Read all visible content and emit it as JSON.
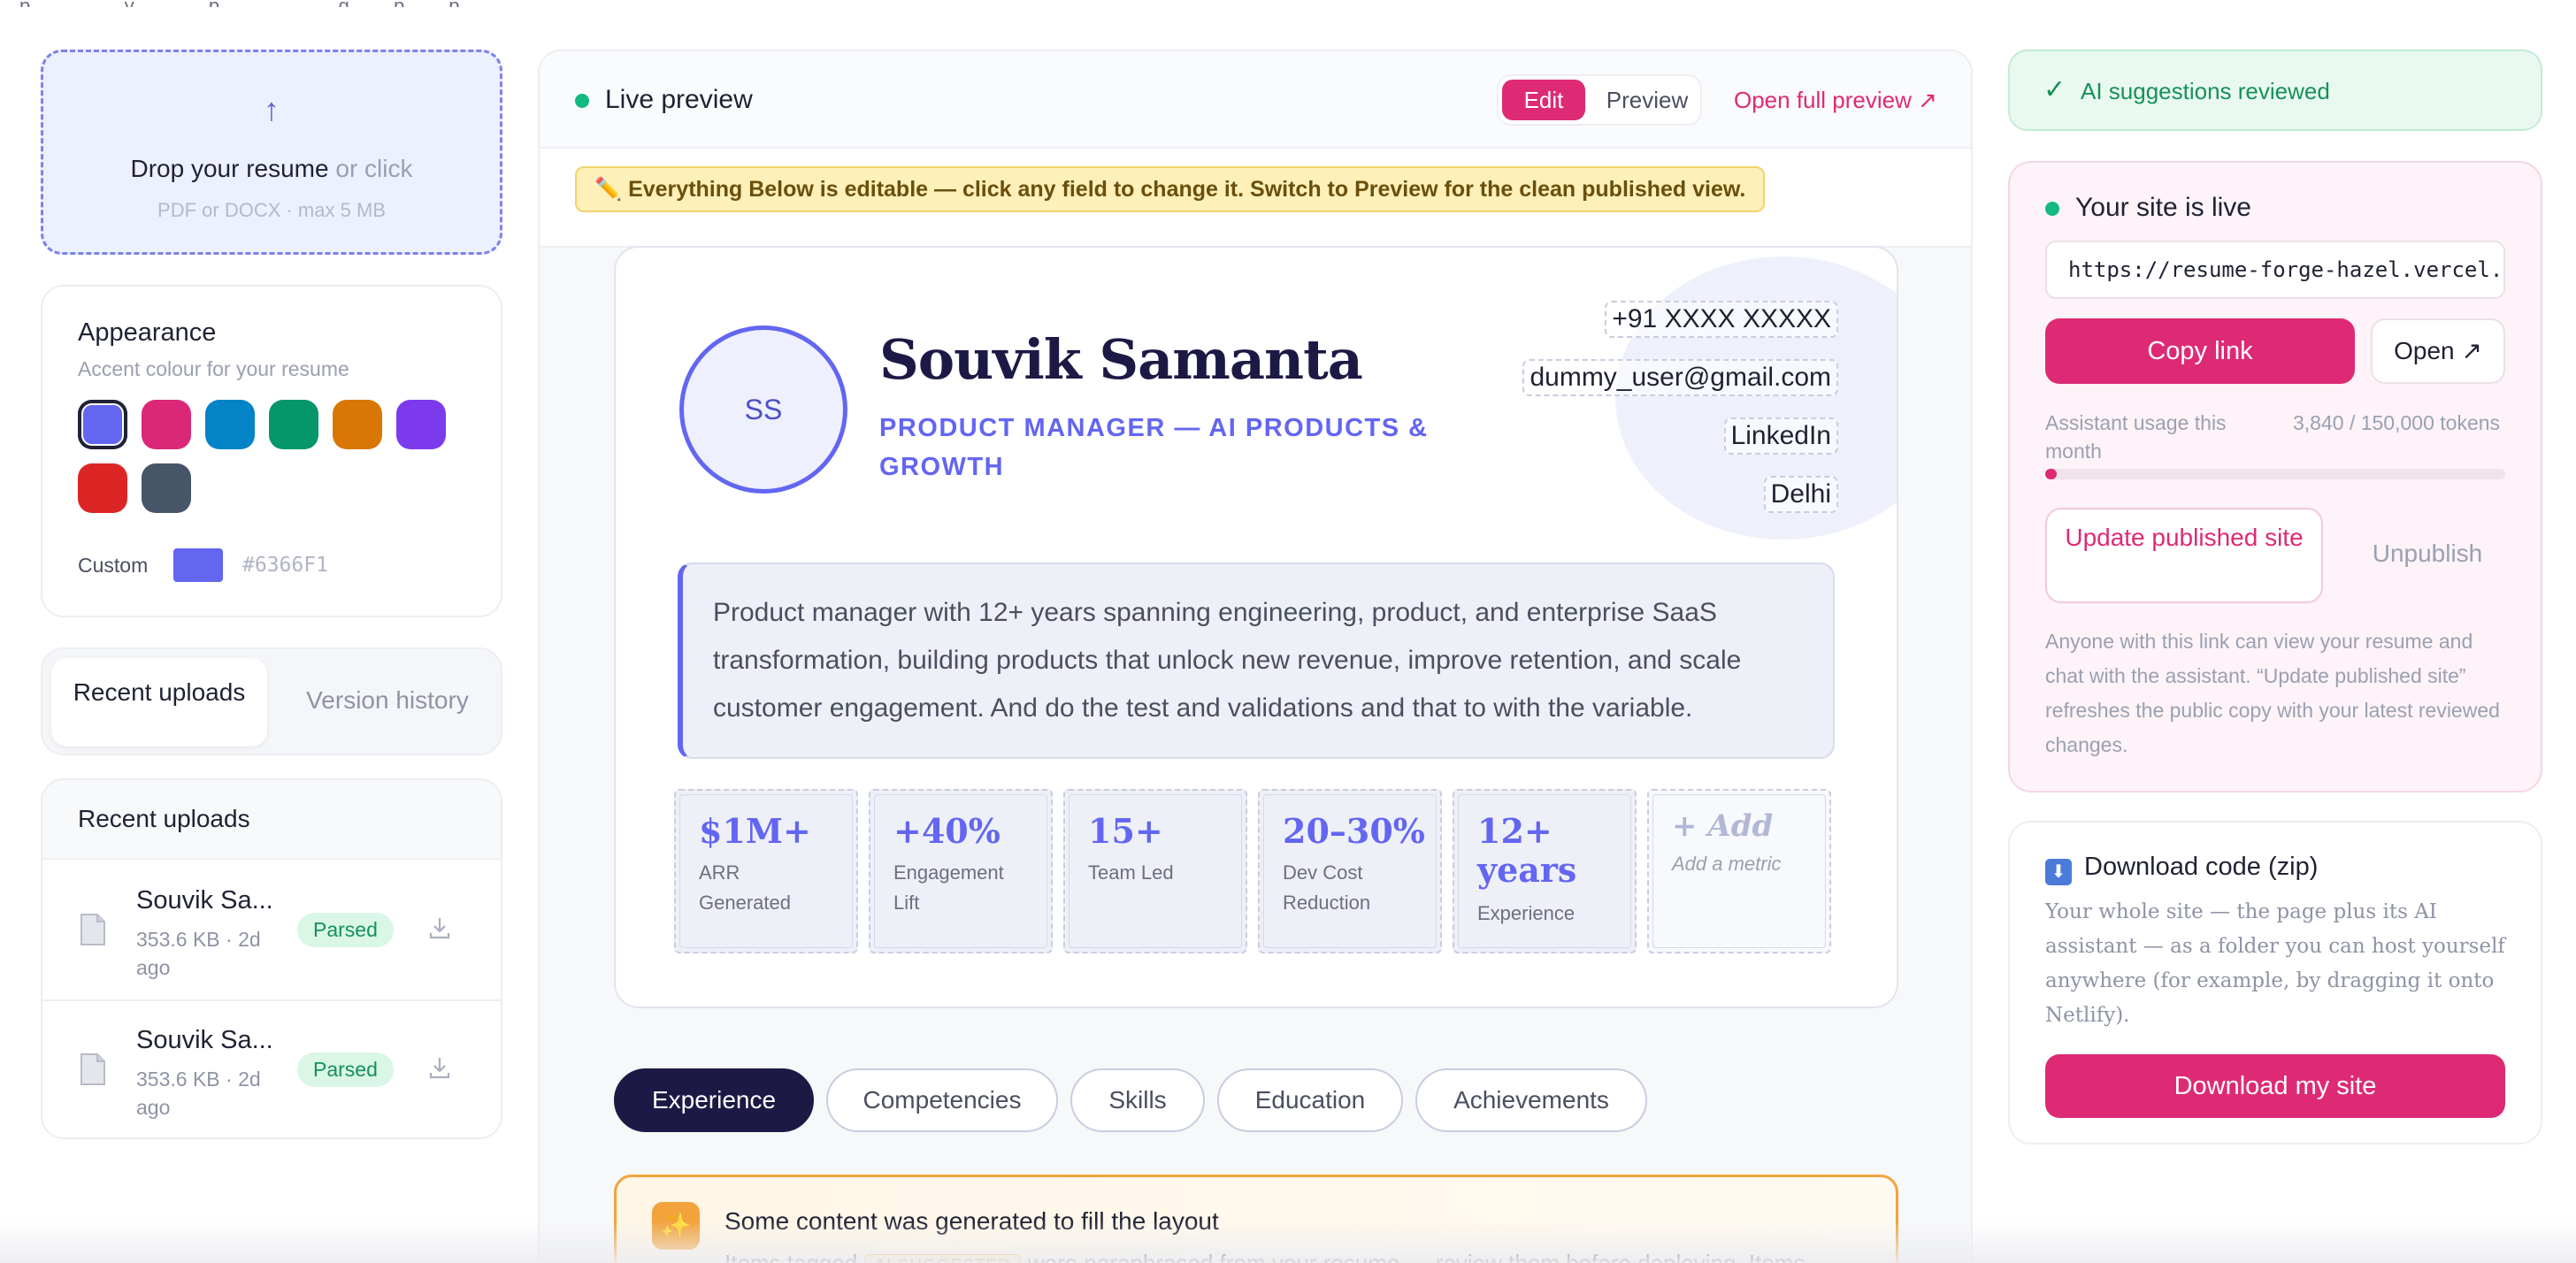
{
  "top_strip": "…p… … … …y … … …p… … … … …g… …p… …p…",
  "upload": {
    "arrow": "↑",
    "title": "Drop your resume",
    "or_click": "or click",
    "hint": "PDF or DOCX · max 5 MB"
  },
  "appearance": {
    "title": "Appearance",
    "subtitle": "Accent colour for your resume",
    "swatches": [
      "#6366F1",
      "#DB2777",
      "#0284C7",
      "#059669",
      "#D97706",
      "#7C3AED",
      "#DC2626",
      "#475569"
    ],
    "selected_index": 0,
    "custom_label": "Custom",
    "custom_hex": "#6366F1"
  },
  "left_tabs": {
    "recent": "Recent uploads",
    "history": "Version history"
  },
  "recent_uploads": {
    "title": "Recent uploads",
    "items": [
      {
        "name": "Souvik Sa...",
        "meta": "353.6 KB · 2d ago",
        "status": "Parsed"
      },
      {
        "name": "Souvik Sa...",
        "meta": "353.6 KB · 2d ago",
        "status": "Parsed"
      }
    ]
  },
  "preview": {
    "live_label": "Live preview",
    "mode_edit": "Edit",
    "mode_preview": "Preview",
    "open_full": "Open full preview ↗",
    "edit_note": "✏️ Everything Below is editable — click any field to change it. Switch to Preview for the clean published view."
  },
  "resume": {
    "initials": "SS",
    "name": "Souvik Samanta",
    "role": "PRODUCT MANAGER — AI PRODUCTS & GROWTH",
    "phone": "+91 XXXX XXXXX",
    "email": "dummy_user@gmail.com",
    "linkedin": "LinkedIn",
    "location": "Delhi",
    "summary": "Product manager with 12+ years spanning engineering, product, and enterprise SaaS transformation, building products that unlock new revenue, improve retention, and scale customer engagement. And do the test and validations and that to with the variable.",
    "metrics": [
      {
        "value": "$1M+",
        "label": "ARR Generated"
      },
      {
        "value": "+40%",
        "label": "Engagement Lift"
      },
      {
        "value": "15+",
        "label": "Team Led"
      },
      {
        "value": "20–30%",
        "label": "Dev Cost Reduction"
      },
      {
        "value": "12+ years",
        "label": "Experience"
      }
    ],
    "add_metric_value": "+ Add",
    "add_metric_label": "Add a metric"
  },
  "section_tabs": [
    "Experience",
    "Competencies",
    "Skills",
    "Education",
    "Achievements"
  ],
  "generated": {
    "icon": "✨",
    "title": "Some content was generated to fill the layout",
    "pre": "Items tagged",
    "tag": "AI SUGGESTED",
    "post": "were paraphrased from your resume — review them before deploying. Items"
  },
  "reviewed": {
    "check": "✓",
    "text": "AI suggestions reviewed"
  },
  "publish": {
    "title": "Your site is live",
    "url": "https://resume-forge-hazel.vercel.app",
    "copy": "Copy link",
    "open": "Open ↗",
    "usage_label": "Assistant usage this month",
    "usage_value": "3,840 / 150,000 tokens",
    "usage_fraction": 0.0256,
    "update": "Update published site",
    "unpublish": "Unpublish",
    "description": "Anyone with this link can view your resume and chat with the assistant. “Update published site” refreshes the public copy with your latest reviewed changes."
  },
  "download": {
    "icon": "⬇",
    "title": "Download code (zip)",
    "description": "Your whole site — the page plus its AI assistant — as a folder you can host yourself anywhere (for example, by dragging it onto Netlify).",
    "button": "Download my site"
  },
  "colors": {
    "accent": "#6366F1",
    "brand_pink": "#DE2A74",
    "live_green": "#12B981"
  }
}
